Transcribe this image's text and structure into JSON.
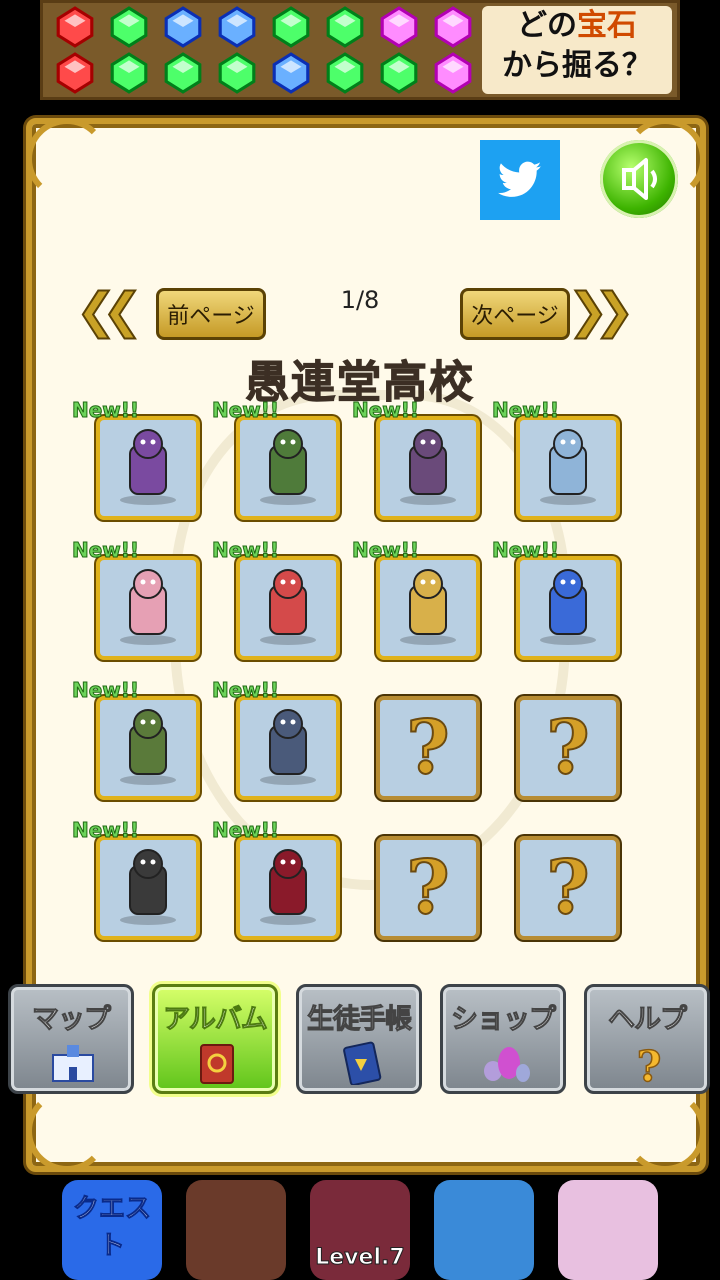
{
  "ad_banner": {
    "line1_before": "どの",
    "line1_highlight": "宝石",
    "line2": "から掘る？",
    "gems_row1": [
      "red",
      "green",
      "blue",
      "blue",
      "green",
      "green",
      "pink",
      "pink"
    ],
    "gems_row2": [
      "red",
      "green",
      "green",
      "green",
      "blue",
      "green",
      "green",
      "pink"
    ]
  },
  "header": {
    "twitter_icon": "twitter-bird-icon",
    "sound_icon": "speaker-icon"
  },
  "pagination": {
    "prev_label": "前ページ",
    "next_label": "次ページ",
    "page_indicator": "1/8"
  },
  "album": {
    "title": "愚連堂高校",
    "new_label": "New!!",
    "locked_label": "?",
    "slots": [
      {
        "state": "new",
        "icon": "hunched-monster-icon"
      },
      {
        "state": "new",
        "icon": "officer-green-icon"
      },
      {
        "state": "new",
        "icon": "officer-purple-icon"
      },
      {
        "state": "new",
        "icon": "trash-can-blue-icon"
      },
      {
        "state": "new",
        "icon": "trash-can-pink-icon"
      },
      {
        "state": "new",
        "icon": "desk-red-icon"
      },
      {
        "state": "new",
        "icon": "desk-yellow-icon"
      },
      {
        "state": "new",
        "icon": "desk-blue-icon"
      },
      {
        "state": "new",
        "icon": "zombie-student-icon"
      },
      {
        "state": "new",
        "icon": "rabbit-teacher-icon"
      },
      {
        "state": "locked",
        "icon": "question-mark-icon"
      },
      {
        "state": "locked",
        "icon": "question-mark-icon"
      },
      {
        "state": "new",
        "icon": "locker-monster-icon"
      },
      {
        "state": "new",
        "icon": "winged-demon-icon"
      },
      {
        "state": "locked",
        "icon": "question-mark-icon"
      },
      {
        "state": "locked",
        "icon": "question-mark-icon"
      }
    ]
  },
  "menu": [
    {
      "label": "マップ",
      "icon": "school-building-icon",
      "active": false
    },
    {
      "label": "アルバム",
      "icon": "album-book-icon",
      "active": true
    },
    {
      "label": "生徒手帳",
      "icon": "student-handbook-icon",
      "active": false
    },
    {
      "label": "ショップ",
      "icon": "gem-eggs-icon",
      "active": false
    },
    {
      "label": "ヘルプ",
      "icon": "question-mark-icon",
      "active": false
    }
  ],
  "bottom_ads": [
    {
      "icon": "quest-app-icon",
      "text": "クエスト"
    },
    {
      "icon": "warrior-app-icon",
      "text": ""
    },
    {
      "icon": "clash-app-icon",
      "text": "Level.7"
    },
    {
      "icon": "pirate-app-icon",
      "text": ""
    },
    {
      "icon": "anime-app-icon",
      "text": ""
    }
  ],
  "colors": {
    "frame_gold": "#c99a2c",
    "frame_bg": "#fffaea",
    "twitter_blue": "#1da1f2",
    "new_green": "#6cd35a",
    "menu_active": "#5fc41a"
  }
}
